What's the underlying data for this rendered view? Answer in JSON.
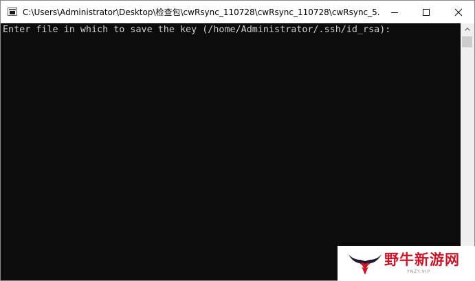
{
  "window": {
    "title": "C:\\Users\\Administrator\\Desktop\\检查包\\cwRsync_110728\\cwRsync_110728\\cwRsync_5.5....",
    "icon": "console-icon",
    "controls": {
      "minimize": "minimize-icon",
      "maximize": "maximize-icon",
      "close": "close-icon"
    }
  },
  "console": {
    "lines": [
      "Enter file in which to save the key (/home/Administrator/.ssh/id_rsa):"
    ],
    "background": "#0c0c0c",
    "foreground": "#cccccc"
  },
  "watermark": {
    "name": "野牛新游网",
    "subtitle": "YNZY.VIP",
    "color": "#c8172a"
  }
}
